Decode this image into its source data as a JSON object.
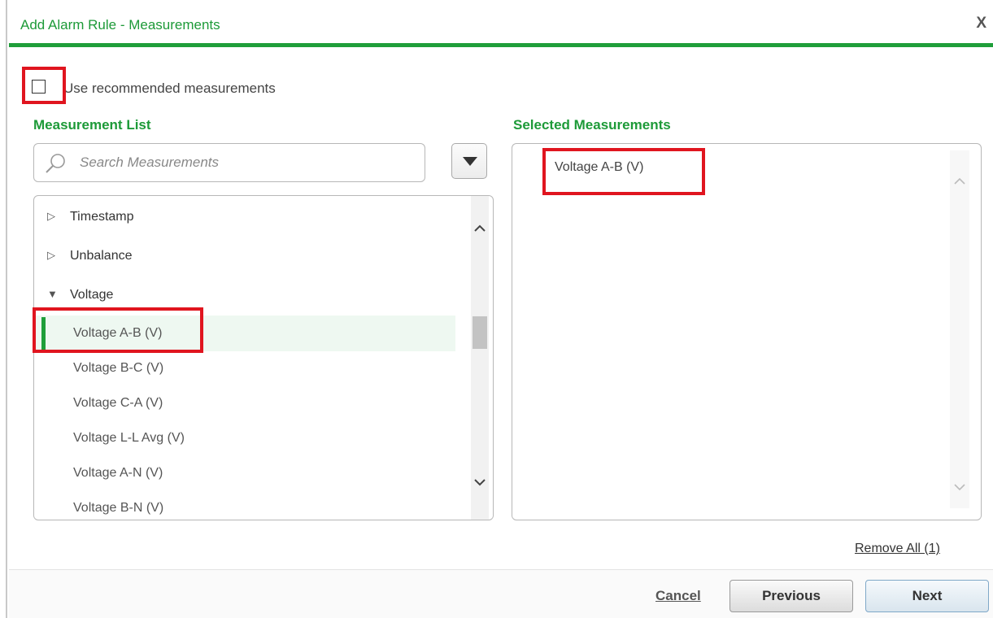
{
  "dialog": {
    "title": "Add Alarm Rule - Measurements",
    "close_label": "X"
  },
  "recommended": {
    "label": "Use recommended measurements",
    "checked": false
  },
  "measurement_list": {
    "title": "Measurement List",
    "search_placeholder": "Search Measurements",
    "groups": [
      {
        "label": "Timestamp",
        "expanded": false
      },
      {
        "label": "Unbalance",
        "expanded": false
      },
      {
        "label": "Voltage",
        "expanded": true
      }
    ],
    "voltage_items": [
      {
        "label": "Voltage A-B (V)",
        "selected": true
      },
      {
        "label": "Voltage B-C (V)"
      },
      {
        "label": "Voltage C-A (V)"
      },
      {
        "label": "Voltage L-L Avg (V)"
      },
      {
        "label": "Voltage A-N (V)"
      },
      {
        "label": "Voltage B-N (V)"
      }
    ]
  },
  "selected_measurements": {
    "title": "Selected Measurements",
    "items": [
      "Voltage A-B (V)"
    ],
    "remove_all_label": "Remove All (1)"
  },
  "footer": {
    "cancel_label": "Cancel",
    "previous_label": "Previous",
    "next_label": "Next"
  },
  "colors": {
    "accent_green": "#1f9e3a",
    "highlight_red": "#e0151f"
  }
}
